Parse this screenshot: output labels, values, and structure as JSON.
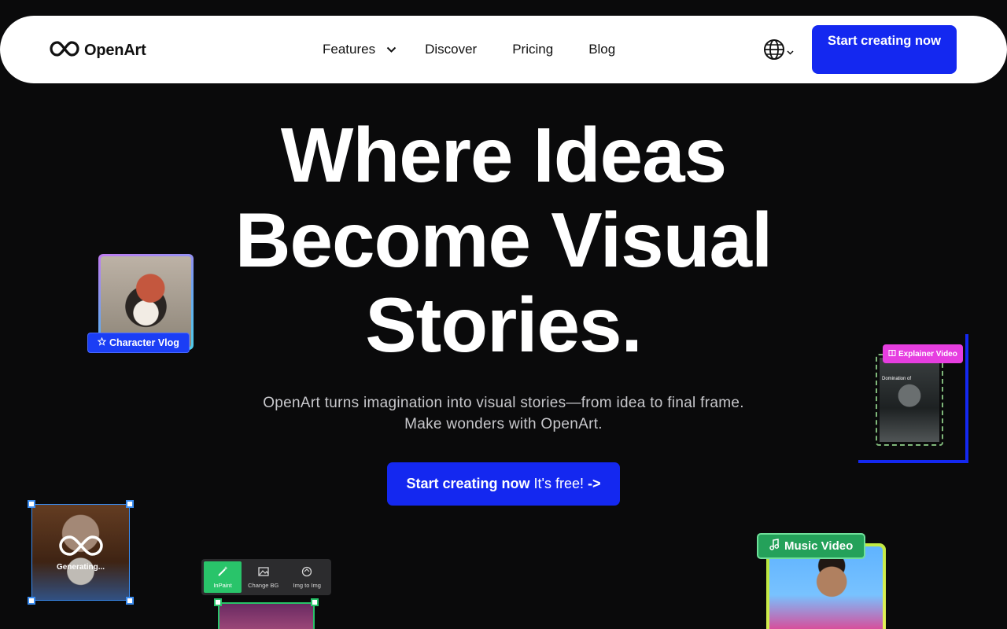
{
  "nav": {
    "logo_text": "OpenArt",
    "links": [
      {
        "label": "Features"
      },
      {
        "label": "Discover"
      },
      {
        "label": "Pricing"
      },
      {
        "label": "Blog"
      }
    ],
    "cta_label": "Start creating now"
  },
  "hero": {
    "title_lines": [
      "Where Ideas",
      "Become Visual",
      "Stories."
    ],
    "subtitle_lines": [
      "OpenArt turns imagination into visual stories—from idea to final frame.",
      "Make wonders with OpenArt."
    ],
    "cta_strong": "Start creating now",
    "cta_light": "It's free!",
    "cta_arrow": "->"
  },
  "cards": {
    "vlog_badge": "Character Vlog",
    "explainer_badge": "Explainer Video",
    "explainer_caption": "Domination of",
    "generating_text": "Generating...",
    "music_badge": "Music Video",
    "toolbar": [
      {
        "label": "InPaint",
        "icon": "wand-icon",
        "active": true
      },
      {
        "label": "Change BG",
        "icon": "image-swap-icon",
        "active": false
      },
      {
        "label": "Img to Img",
        "icon": "refresh-icon",
        "active": false
      }
    ]
  },
  "colors": {
    "accent": "#1428f0",
    "background": "#0a0a0b",
    "green": "#29c46a",
    "magenta": "#e63ee0"
  }
}
